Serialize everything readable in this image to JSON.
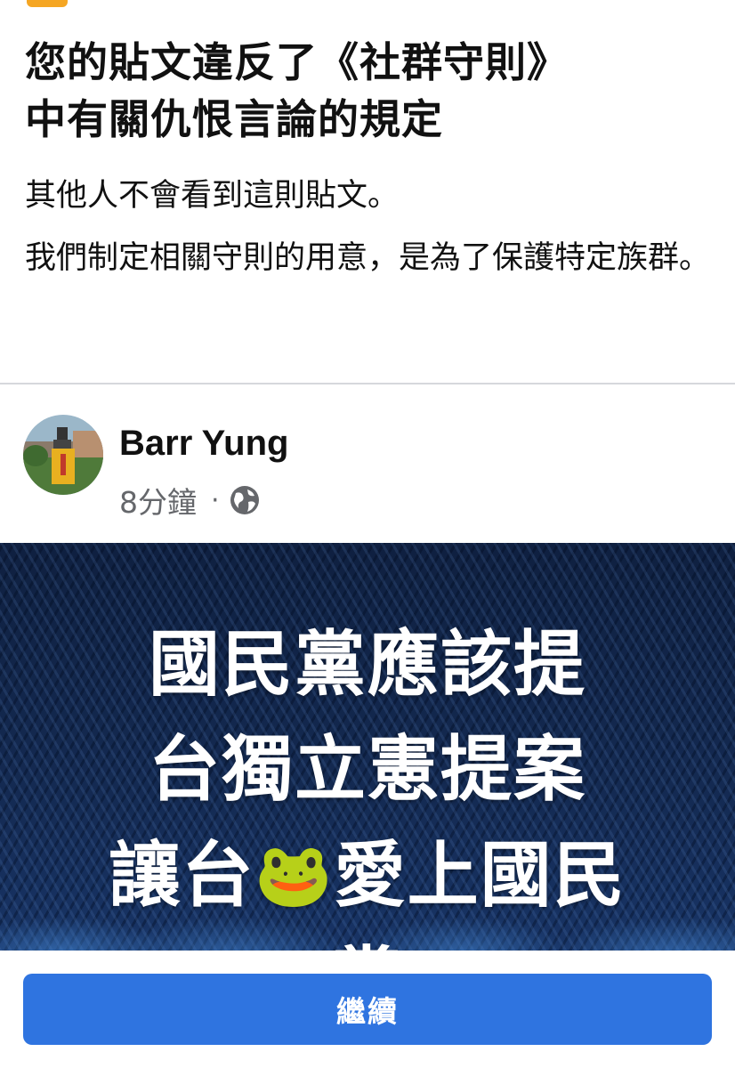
{
  "notice": {
    "title_line1": "您的貼文違反了《社群守則》",
    "title_line2": "中有關仇恨言論的規定",
    "line1": "其他人不會看到這則貼文。",
    "line2": "我們制定相關守則的用意，是為了保護特定族群。"
  },
  "post": {
    "author": "Barr Yung",
    "time": "8分鐘",
    "separator": "·",
    "privacy_icon": "globe-icon",
    "text_lines": [
      "國民黨應該提",
      "台獨立憲提案",
      "讓台",
      "愛上國民",
      "黨"
    ],
    "emoji": "🐸"
  },
  "footer": {
    "continue_label": "繼續"
  },
  "colors": {
    "button": "#2f74e0",
    "meta": "#65676b"
  }
}
